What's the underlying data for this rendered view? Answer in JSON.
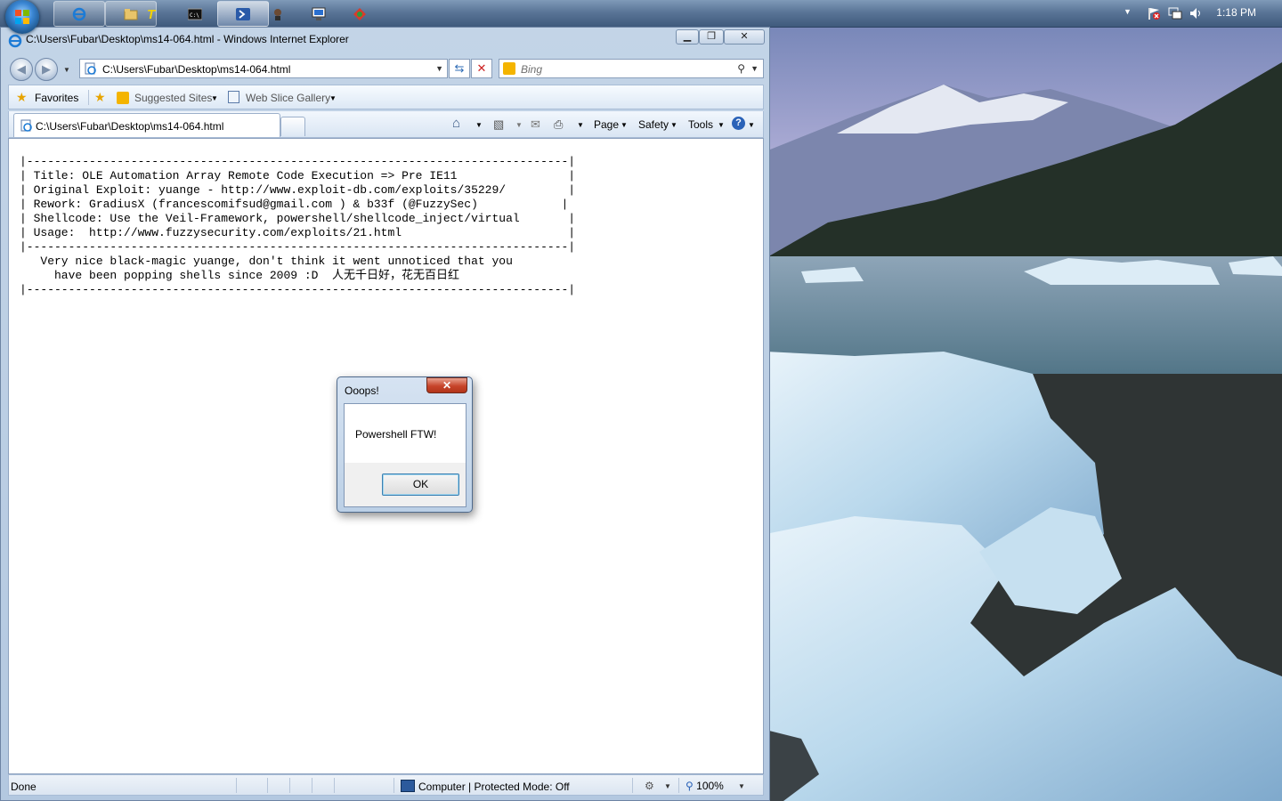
{
  "taskbar": {
    "clock": "1:18 PM",
    "buttons": [
      "internet-explorer",
      "windows-explorer",
      "text-editor",
      "command-prompt",
      "powershell",
      "user-tool",
      "network-monitor",
      "tool"
    ]
  },
  "ie_window": {
    "title": "C:\\Users\\Fubar\\Desktop\\ms14-064.html - Windows Internet Explorer",
    "address": "C:\\Users\\Fubar\\Desktop\\ms14-064.html",
    "search_placeholder": "Bing",
    "favorites_bar": {
      "favorites_label": "Favorites",
      "suggested_sites": "Suggested Sites",
      "web_slice_gallery": "Web Slice Gallery"
    },
    "tab": {
      "label": "C:\\Users\\Fubar\\Desktop\\ms14-064.html"
    },
    "commands": {
      "page": "Page",
      "safety": "Safety",
      "tools": "Tools"
    },
    "content_text": "|------------------------------------------------------------------------------|\n| Title: OLE Automation Array Remote Code Execution => Pre IE11                |\n| Original Exploit: yuange - http://www.exploit-db.com/exploits/35229/         |\n| Rework: GradiusX (francescomifsud@gmail.com ) & b33f (@FuzzySec)            |\n| Shellcode: Use the Veil-Framework, powershell/shellcode_inject/virtual       |\n| Usage:  http://www.fuzzysecurity.com/exploits/21.html                        |\n|------------------------------------------------------------------------------|\n   Very nice black-magic yuange, don't think it went unnoticed that you\n     have been popping shells since 2009 :D  人无千日好，花无百日红\n|------------------------------------------------------------------------------|",
    "status": {
      "text": "Done",
      "zone": "Computer | Protected Mode: Off",
      "zoom": "100%"
    }
  },
  "dialog": {
    "title": "Ooops!",
    "message": "Powershell FTW!",
    "ok_label": "OK"
  },
  "colors": {
    "taskbar": "#4d6a8f",
    "window_chrome": "#c3d4e7",
    "dialog_close": "#c7442a"
  }
}
